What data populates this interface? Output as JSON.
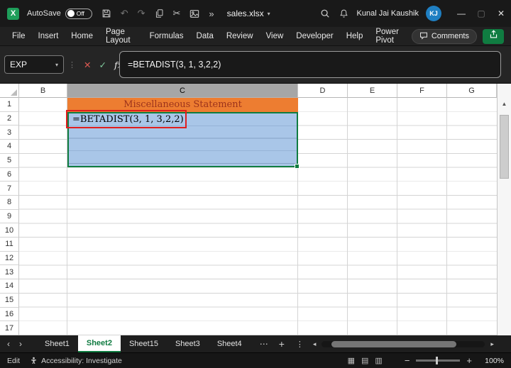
{
  "colors": {
    "accent_green": "#107C41",
    "selection_blue": "#A9C6E8",
    "cell_orange": "#ED7D31",
    "cell_orange_text": "#9C331C",
    "annotation_red": "#E01E1E",
    "avatar_blue": "#1F7FC2"
  },
  "glyphs": {
    "logo_letter": "X",
    "undo": "↶",
    "redo": "↷",
    "cut": "✂",
    "more_chevron": "»",
    "dropdown": "▾",
    "minimize": "—",
    "maximize": "▢",
    "close": "✕",
    "grip_dots": "⋮",
    "cancel": "✕",
    "enter": "✓",
    "fx": "fx",
    "up_arrow": "▲",
    "nav_left": "‹",
    "nav_right": "›",
    "tab_more": "⋯",
    "add_sheet": "+",
    "scroll_left": "◂",
    "scroll_right": "▸",
    "zoom_minus": "−",
    "zoom_plus": "+",
    "view_normal": "▦",
    "view_layout": "▤",
    "view_break": "▥"
  },
  "titlebar": {
    "autosave_label": "AutoSave",
    "autosave_state": "Off",
    "filename": "sales.xlsx",
    "user_name": "Kunal Jai Kaushik",
    "user_initials": "KJ"
  },
  "ribbon": {
    "tabs": [
      "File",
      "Insert",
      "Home",
      "Page Layout",
      "Formulas",
      "Data",
      "Review",
      "View",
      "Developer",
      "Help",
      "Power Pivot"
    ],
    "comments_label": "Comments"
  },
  "formula_bar": {
    "name_box": "EXP",
    "formula": "=BETADIST(3, 1, 3,2,2)"
  },
  "grid": {
    "columns": [
      "B",
      "C",
      "D",
      "E",
      "F",
      "G"
    ],
    "selected_column": "C",
    "row_numbers": [
      "1",
      "2",
      "3",
      "4",
      "5",
      "6",
      "7",
      "8",
      "9",
      "10",
      "11",
      "12",
      "13",
      "14",
      "15",
      "16",
      "17"
    ],
    "cells": {
      "c1": "Miscellaneous Statement",
      "c2": "=BETADIST(3, 1, 3,2,2)"
    },
    "selection": "C2:C5"
  },
  "sheet_bar": {
    "tabs": [
      {
        "label": "Sheet1",
        "active": false
      },
      {
        "label": "Sheet2",
        "active": true
      },
      {
        "label": "Sheet15",
        "active": false
      },
      {
        "label": "Sheet3",
        "active": false
      },
      {
        "label": "Sheet4",
        "active": false
      }
    ]
  },
  "status_bar": {
    "mode": "Edit",
    "accessibility": "Accessibility: Investigate",
    "zoom": "100%"
  }
}
